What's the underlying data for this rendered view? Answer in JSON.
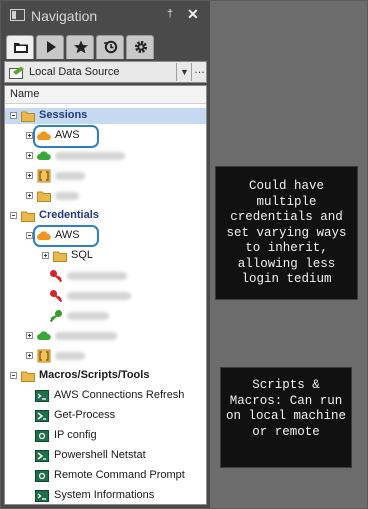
{
  "panel": {
    "title": "Navigation",
    "pin_glyph": "†",
    "close_glyph": "✕",
    "tabs": [
      "folder-icon",
      "play-icon",
      "star-icon",
      "history-icon",
      "gear-icon"
    ],
    "data_source": "Local Data Source",
    "dropdown_glyph": "▼",
    "more_glyph": "…",
    "column_header": "Name"
  },
  "tree": {
    "sessions_label": "Sessions",
    "sessions_aws": "AWS",
    "credentials_label": "Credentials",
    "credentials_aws": "AWS",
    "sql_label": "SQL",
    "macros_label": "Macros/Scripts/Tools",
    "macros": [
      "AWS Connections Refresh",
      "Get-Process",
      "IP config",
      "Powershell Netstat",
      "Remote Command Prompt",
      "System Informations"
    ]
  },
  "notes": {
    "credentials_note": "Could have multiple credentials and set varying ways to inherit, allowing less login tedium",
    "macros_note": "Scripts & Macros: Can run on local machine or remote"
  },
  "colors": {
    "panel_bg": "#4a4a4a",
    "workspace_bg": "#6c6c6c",
    "selection": "#c5daf0",
    "highlight_ring": "#2f7fc1",
    "aws_cloud": "#f0961e",
    "green_cloud": "#3aa63a",
    "key_red": "#d8232a",
    "key_green": "#3a9a2a",
    "folder": "#e8b84a"
  }
}
